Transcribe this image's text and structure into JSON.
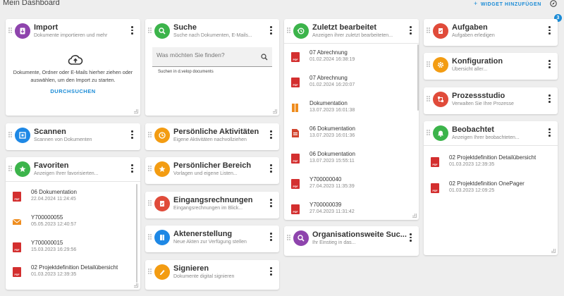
{
  "header": {
    "title": "Mein Dashboard",
    "add_widget_plus": "+",
    "add_widget": "WIDGET HINZUFÜGEN",
    "badge_count": "3",
    "compass_icon": "compass-icon"
  },
  "colors": {
    "accent": "#1a8bd6",
    "purple": "#8e44ad",
    "green": "#3cb44b",
    "blue": "#1e88e5",
    "orange": "#f39c12",
    "red": "#e04b3a",
    "pdf_red": "#d32f2f",
    "mail_orange": "#ef8d1f"
  },
  "widgets": {
    "import": {
      "title": "Import",
      "subtitle": "Dokumente importieren und mehr",
      "body": "Dokumente, Ordner oder E-Mails hierher ziehen oder auswählen, um den Import zu starten.",
      "link": "DURCHSUCHEN",
      "icon": "import-icon"
    },
    "suche": {
      "title": "Suche",
      "subtitle": "Suche nach Dokumenten, E-Mails...",
      "placeholder": "Was möchten Sie finden?",
      "hint": "Suchen in d.velop documents",
      "icon": "search-icon"
    },
    "zuletzt": {
      "title": "Zuletzt bearbeitet",
      "subtitle": "Anzeigen ihrer zuletzt bearbeiteten...",
      "icon": "history-icon",
      "items": [
        {
          "title": "07 Abrechnung",
          "date": "01.02.2024 16:38:19",
          "type": "pdf"
        },
        {
          "title": "07 Abrechnung",
          "date": "01.02.2024 16:20:07",
          "type": "pdf"
        },
        {
          "title": "Dokumentation",
          "date": "13.07.2023 16:01:38",
          "type": "folder"
        },
        {
          "title": "06 Dokumentation",
          "date": "13.07.2023 16:01:36",
          "type": "doc"
        },
        {
          "title": "06 Dokumentation",
          "date": "13.07.2023 15:55:11",
          "type": "pdf"
        },
        {
          "title": "Y700000040",
          "date": "27.04.2023 11:35:39",
          "type": "pdf"
        },
        {
          "title": "Y700000039",
          "date": "27.04.2023 11:31:42",
          "type": "pdf"
        }
      ]
    },
    "aufgaben": {
      "title": "Aufgaben",
      "subtitle": "Aufgaben erledigen",
      "icon": "task-icon"
    },
    "konfiguration": {
      "title": "Konfiguration",
      "subtitle": "Übersicht aller...",
      "icon": "gear-icon"
    },
    "prozessstudio": {
      "title": "Prozessstudio",
      "subtitle": "Verwalten Sie Ihre Prozesse",
      "icon": "process-icon"
    },
    "beobachtet": {
      "title": "Beobachtet",
      "subtitle": "Anzeigen Ihrer beobachteten...",
      "icon": "bell-icon",
      "items": [
        {
          "title": "02 Projektdefinition Detailübersicht",
          "date": "01.03.2023 12:39:35",
          "type": "pdf"
        },
        {
          "title": "02 Projektdefinition OnePager",
          "date": "01.03.2023 12:09:25",
          "type": "pdf"
        }
      ]
    },
    "scannen": {
      "title": "Scannen",
      "subtitle": "Scannen von Dokumenten",
      "icon": "scan-icon"
    },
    "favoriten": {
      "title": "Favoriten",
      "subtitle": "Anzeigen Ihrer favorisierten...",
      "icon": "star-icon",
      "items": [
        {
          "title": "06 Dokumentation",
          "date": "22.04.2024 11:24:45",
          "type": "pdf"
        },
        {
          "title": "Y700000055",
          "date": "05.05.2023 12:40:57",
          "type": "mail"
        },
        {
          "title": "Y700000015",
          "date": "15.03.2023 16:29:56",
          "type": "pdf"
        },
        {
          "title": "02 Projektdefinition Detailübersicht",
          "date": "01.03.2023 12:39:35",
          "type": "pdf"
        }
      ]
    },
    "aktivitaeten": {
      "title": "Persönliche Aktivitäten",
      "subtitle": "Eigene Aktivitäten nachvollziehen",
      "icon": "clock-icon"
    },
    "bereich": {
      "title": "Persönlicher Bereich",
      "subtitle": "Vorlagen und eigene Listen...",
      "icon": "star-icon"
    },
    "eingangsrechnungen": {
      "title": "Eingangsrechnungen",
      "subtitle": "Eingangsrechnungen im Blick...",
      "icon": "invoice-icon"
    },
    "aktenerstellung": {
      "title": "Aktenerstellung",
      "subtitle": "Neue Akten zur Verfügung stellen",
      "icon": "folder-icon"
    },
    "signieren": {
      "title": "Signieren",
      "subtitle": "Dokumente digital signieren",
      "icon": "sign-icon"
    },
    "organisationssuche": {
      "title": "Organisationsweite Suc...",
      "subtitle": "Ihr Einstieg in das...",
      "icon": "search-icon"
    }
  }
}
